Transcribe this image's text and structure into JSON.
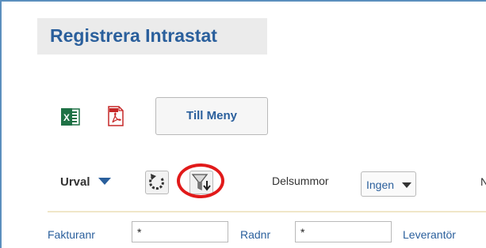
{
  "page": {
    "title": "Registrera Intrastat"
  },
  "toolbar": {
    "excel_icon": "excel-icon",
    "pdf_icon": "pdf-icon",
    "menu_label": "Till Meny"
  },
  "filterbar": {
    "urval_label": "Urval",
    "delsummor_label": "Delsummor",
    "delsummor_value": "Ingen",
    "partial_label": "N",
    "reset_icon": "refresh-icon",
    "filter_icon": "filter-sort-icon",
    "highlight_color": "#e11a1a"
  },
  "fields": {
    "fakturanr_label": "Fakturanr",
    "fakturanr_value": "*",
    "radnr_label": "Radnr",
    "radnr_value": "*",
    "leverantor_label": "Leverantör"
  },
  "colors": {
    "accent": "#2a5f9c",
    "frame": "#5b8fbe"
  }
}
